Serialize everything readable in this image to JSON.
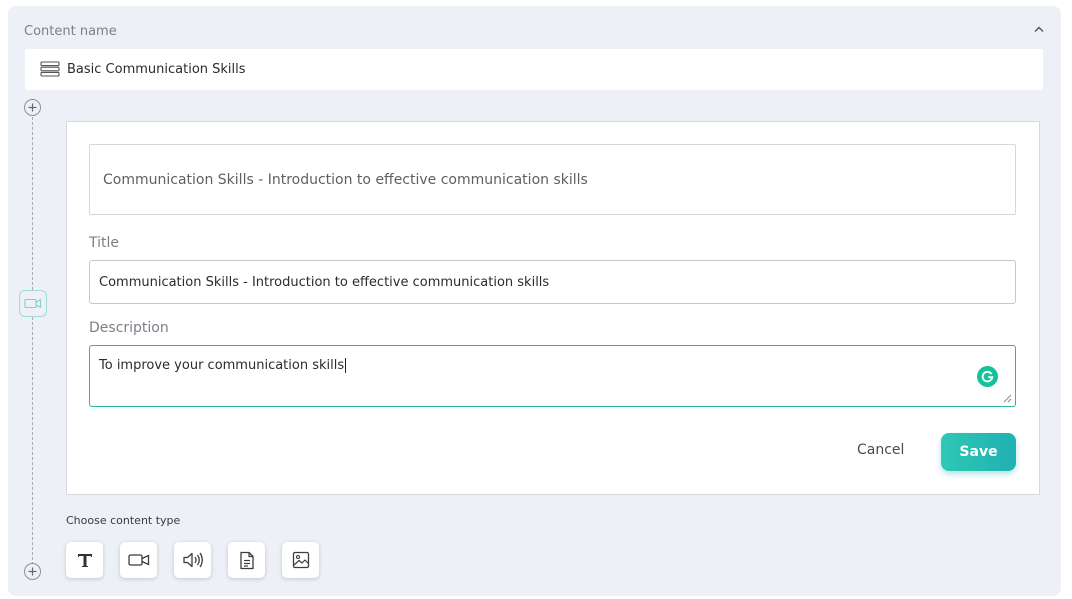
{
  "content_name": {
    "label": "Content name",
    "value": "Basic Communication Skills",
    "icon": "layers-icon"
  },
  "card": {
    "heading": "Communication Skills - Introduction to effective communication skills",
    "title_label": "Title",
    "title_value": "Communication Skills - Introduction to effective communication skills",
    "description_label": "Description",
    "description_value": "To improve your communication skills",
    "cancel_label": "Cancel",
    "save_label": "Save"
  },
  "content_types": {
    "label": "Choose content type",
    "items": [
      "text-icon",
      "video-icon",
      "audio-icon",
      "document-icon",
      "image-icon"
    ]
  },
  "colors": {
    "accent": "#27b7a5",
    "panel_bg": "#eef0f7",
    "grammarly": "#15c39a"
  }
}
